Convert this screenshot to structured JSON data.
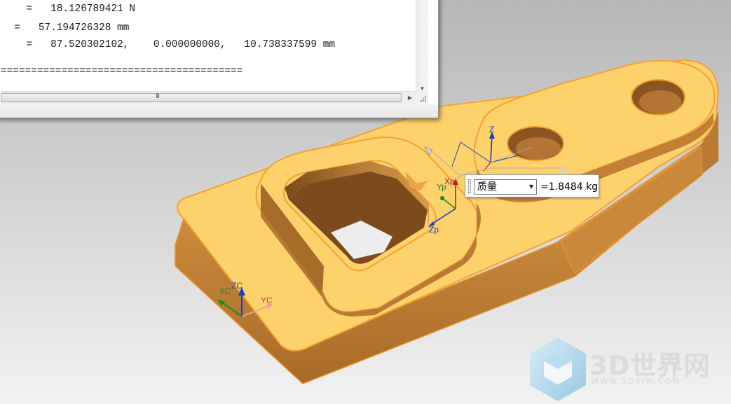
{
  "info_window": {
    "lines": [
      "    =   18.126789421 N",
      "  =   57.194726328 mm",
      "    =   87.520302102,    0.000000000,   10.738337599 mm",
      "",
      "========================================"
    ],
    "scrollbar_grip": "III"
  },
  "mass_tooltip": {
    "selected_option": "质量",
    "value_text": "=1.8484 kg"
  },
  "csys_labels": {
    "zp": "Zp",
    "yp": "Yp",
    "xp": "Xp",
    "z": "Z",
    "zc": "ZC",
    "yc": "YC",
    "xc": "XC"
  },
  "watermark": {
    "name": "3D世界网",
    "url": "WWW.3DSJW.COM"
  },
  "colors": {
    "part_top": "#fdd06a",
    "part_side": "#c8873a",
    "part_edge": "#f0a030",
    "background_top": "#b9b9b9",
    "background_bottom": "#f1f1f1"
  }
}
